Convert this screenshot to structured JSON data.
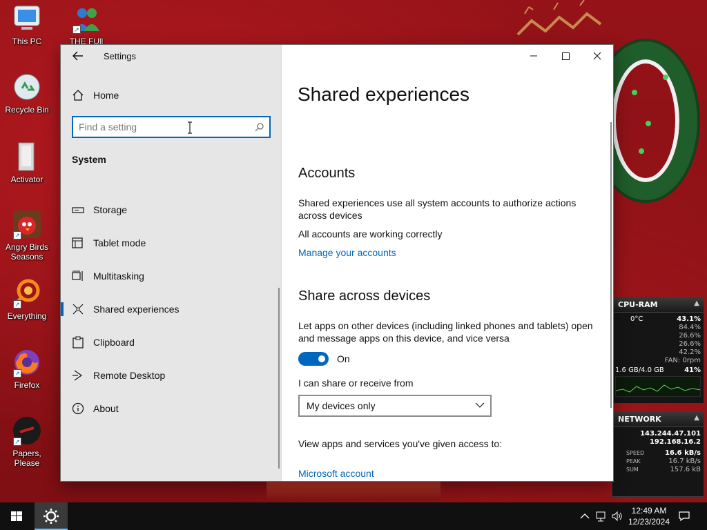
{
  "desktop": {
    "icons": [
      {
        "label": "This PC"
      },
      {
        "label": "Recycle Bin"
      },
      {
        "label": "Activator"
      },
      {
        "label": "Angry Birds Seasons"
      },
      {
        "label": "Everything"
      },
      {
        "label": "Firefox"
      },
      {
        "label": "Papers, Please"
      },
      {
        "label": "THE FUll"
      }
    ]
  },
  "gadgets": {
    "cpu_ram": {
      "title": "CPU-RAM",
      "temp": "0°C",
      "cpu_total": "43.1%",
      "cores": [
        "84.4%",
        "26.6%",
        "26.6%",
        "42.2%"
      ],
      "fan": "FAN: 0rpm",
      "ram_usage": "1.6 GB/4.0 GB",
      "ram_percent": "41%"
    },
    "network": {
      "title": "NETWORK",
      "ip_public": "143.244.47.101",
      "ip_local": "192.168.16.2",
      "speed_label": "SPEED",
      "speed_value": "16.6 kB/s",
      "peak_label": "PEAK",
      "peak_value": "16.7 kB/s",
      "sum_label": "SUM",
      "sum_value": "157.6 kB"
    }
  },
  "window": {
    "app_title": "Settings",
    "nav": {
      "home_label": "Home",
      "search_placeholder": "Find a setting",
      "section_header": "System",
      "items": [
        {
          "label": "Storage",
          "icon": "storage-icon"
        },
        {
          "label": "Tablet mode",
          "icon": "tablet-mode-icon"
        },
        {
          "label": "Multitasking",
          "icon": "multitasking-icon"
        },
        {
          "label": "Shared experiences",
          "icon": "shared-experiences-icon",
          "selected": true
        },
        {
          "label": "Clipboard",
          "icon": "clipboard-icon"
        },
        {
          "label": "Remote Desktop",
          "icon": "remote-desktop-icon"
        },
        {
          "label": "About",
          "icon": "info-icon"
        }
      ]
    },
    "content": {
      "page_title": "Shared experiences",
      "accounts": {
        "heading": "Accounts",
        "description": "Shared experiences use all system accounts to authorize actions across devices",
        "status": "All accounts are working correctly",
        "manage_link": "Manage your accounts"
      },
      "share_across": {
        "heading": "Share across devices",
        "description": "Let apps on other devices (including linked phones and tablets) open and message apps on this device, and vice versa",
        "toggle_state": "On",
        "share_from_label": "I can share or receive from",
        "dropdown_value": "My devices only",
        "access_text": "View apps and services you've given access to:",
        "ms_account_link": "Microsoft account"
      }
    }
  },
  "taskbar": {
    "time": "12:49 AM",
    "date": "12/23/2024"
  },
  "colors": {
    "accent": "#0067c0",
    "nav_bg": "#e6e6e6",
    "taskbar_bg": "#101010"
  }
}
